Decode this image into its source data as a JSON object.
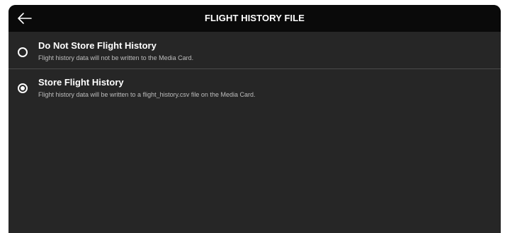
{
  "header": {
    "title": "FLIGHT HISTORY FILE",
    "back_icon": "arrow-left-icon"
  },
  "options": [
    {
      "label": "Do Not Store Flight History",
      "description": "Flight history data will not be written to the Media Card.",
      "selected": false
    },
    {
      "label": "Store Flight History",
      "description": "Flight history data will be written to a flight_history.csv file on the Media Card.",
      "selected": true
    }
  ],
  "colors": {
    "panel_background": "#262626",
    "header_background": "#0a0a0a",
    "text_primary": "#ffffff",
    "text_secondary": "#bdbdbd",
    "divider": "#4a4a4a"
  }
}
